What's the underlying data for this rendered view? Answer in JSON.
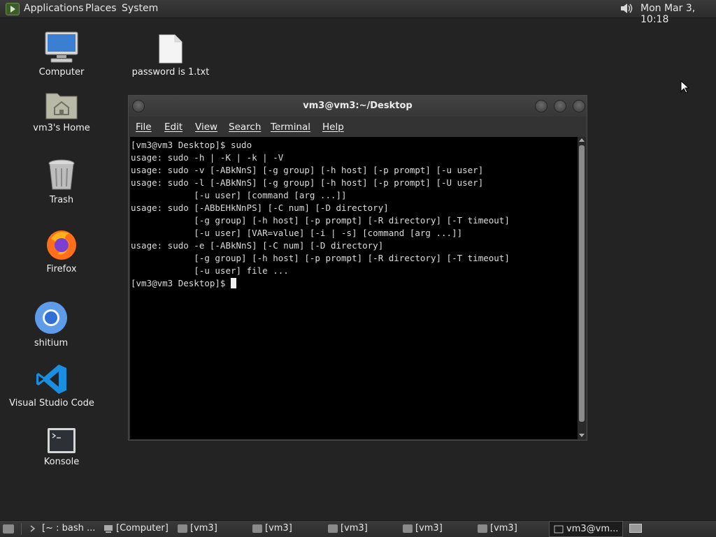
{
  "top_panel": {
    "menus": [
      "Applications",
      "Places",
      "System"
    ],
    "clock": "Mon Mar  3, 10:18"
  },
  "desktop_icons": {
    "computer": "Computer",
    "home": "vm3's Home",
    "trash": "Trash",
    "firefox": "Firefox",
    "shitium": "shitium",
    "vscode": "Visual Studio Code",
    "konsole": "Konsole",
    "file": "password is 1.txt"
  },
  "terminal": {
    "title": "vm3@vm3:~/Desktop",
    "menu": [
      "File",
      "Edit",
      "View",
      "Search",
      "Terminal",
      "Help"
    ],
    "lines": [
      "[vm3@vm3 Desktop]$ sudo",
      "usage: sudo -h | -K | -k | -V",
      "usage: sudo -v [-ABkNnS] [-g group] [-h host] [-p prompt] [-u user]",
      "usage: sudo -l [-ABkNnS] [-g group] [-h host] [-p prompt] [-U user]",
      "            [-u user] [command [arg ...]]",
      "usage: sudo [-ABbEHkNnPS] [-C num] [-D directory]",
      "            [-g group] [-h host] [-p prompt] [-R directory] [-T timeout]",
      "            [-u user] [VAR=value] [-i | -s] [command [arg ...]]",
      "usage: sudo -e [-ABkNnS] [-C num] [-D directory]",
      "            [-g group] [-h host] [-p prompt] [-R directory] [-T timeout]",
      "            [-u user] file ...",
      "[vm3@vm3 Desktop]$ "
    ]
  },
  "taskbar": {
    "items": [
      "[~ : bash ...",
      "[Computer]",
      "[vm3]",
      "[vm3]",
      "[vm3]",
      "[vm3]",
      "[vm3]",
      "vm3@vm..."
    ]
  }
}
